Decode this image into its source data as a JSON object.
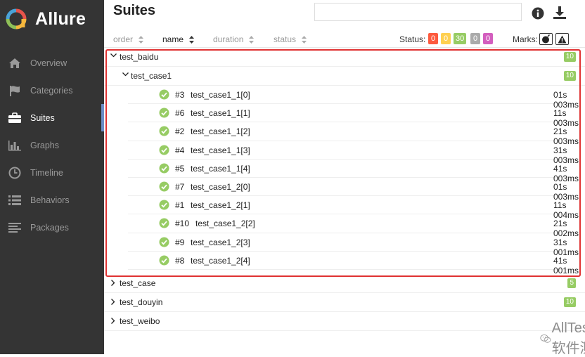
{
  "app": {
    "name": "Allure"
  },
  "nav": [
    {
      "label": "Overview",
      "icon": "home-icon"
    },
    {
      "label": "Categories",
      "icon": "flag-icon"
    },
    {
      "label": "Suites",
      "icon": "briefcase-icon",
      "active": true
    },
    {
      "label": "Graphs",
      "icon": "bar-chart-icon"
    },
    {
      "label": "Timeline",
      "icon": "clock-icon"
    },
    {
      "label": "Behaviors",
      "icon": "list-icon"
    },
    {
      "label": "Packages",
      "icon": "align-left-icon"
    }
  ],
  "page": {
    "title": "Suites",
    "search_value": ""
  },
  "sort": {
    "order": "order",
    "name": "name",
    "duration": "duration",
    "status": "status",
    "active": "name"
  },
  "status": {
    "label": "Status:",
    "counts": [
      {
        "value": "0",
        "color": "#fd5a3e"
      },
      {
        "value": "0",
        "color": "#ffd050"
      },
      {
        "value": "30",
        "color": "#97cc64"
      },
      {
        "value": "0",
        "color": "#aaaaaa"
      },
      {
        "value": "0",
        "color": "#d35ebe"
      }
    ]
  },
  "marks": {
    "label": "Marks:",
    "items": [
      "flaky-icon",
      "warning-icon"
    ]
  },
  "tree": {
    "suites": [
      {
        "name": "test_baidu",
        "count": "10",
        "expanded": true,
        "children": [
          {
            "name": "test_case1",
            "count": "10",
            "expanded": true,
            "tests": [
              {
                "num": "#3",
                "name": "test_case1_1[0]",
                "idx": "0",
                "dur": "1s 003ms"
              },
              {
                "num": "#6",
                "name": "test_case1_1[1]",
                "idx": "1",
                "dur": "1s 003ms"
              },
              {
                "num": "#2",
                "name": "test_case1_1[2]",
                "idx": "2",
                "dur": "1s 003ms"
              },
              {
                "num": "#4",
                "name": "test_case1_1[3]",
                "idx": "3",
                "dur": "1s 003ms"
              },
              {
                "num": "#5",
                "name": "test_case1_1[4]",
                "idx": "4",
                "dur": "1s 003ms"
              },
              {
                "num": "#7",
                "name": "test_case1_2[0]",
                "idx": "0",
                "dur": "1s 003ms"
              },
              {
                "num": "#1",
                "name": "test_case1_2[1]",
                "idx": "1",
                "dur": "1s 004ms"
              },
              {
                "num": "#10",
                "name": "test_case1_2[2]",
                "idx": "2",
                "dur": "1s 002ms"
              },
              {
                "num": "#9",
                "name": "test_case1_2[3]",
                "idx": "3",
                "dur": "1s 001ms"
              },
              {
                "num": "#8",
                "name": "test_case1_2[4]",
                "idx": "4",
                "dur": "1s 001ms"
              }
            ]
          }
        ]
      },
      {
        "name": "test_case",
        "count": "5",
        "expanded": false
      },
      {
        "name": "test_douyin",
        "count": "10",
        "expanded": false
      },
      {
        "name": "test_weibo",
        "count": "",
        "expanded": false
      }
    ]
  },
  "watermark": "AllTests软件测试",
  "colors": {
    "sidebar": "#343434",
    "passed": "#97cc64",
    "highlight": "#e03232"
  }
}
